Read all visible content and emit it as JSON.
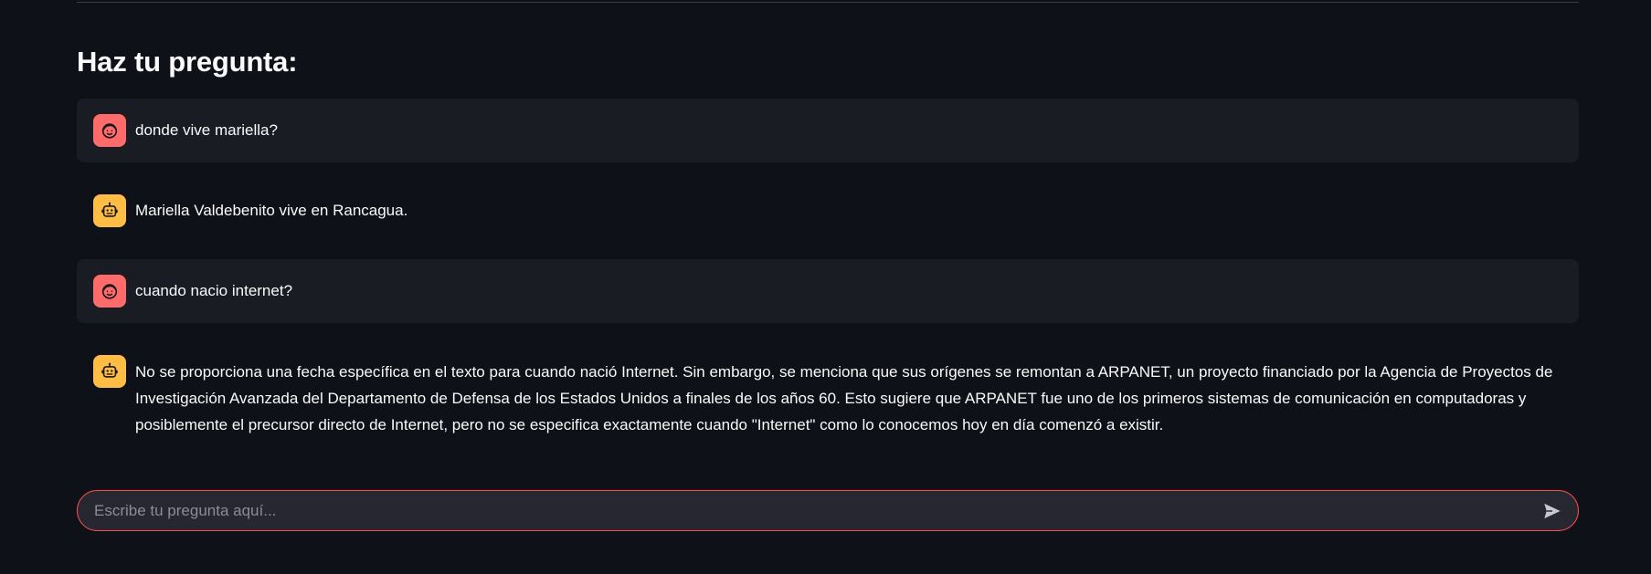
{
  "heading": "Haz tu pregunta:",
  "messages": [
    {
      "role": "user",
      "avatar_icon": "user-face-icon",
      "text": "donde vive mariella?"
    },
    {
      "role": "assistant",
      "avatar_icon": "robot-icon",
      "text": "Mariella Valdebenito vive en Rancagua."
    },
    {
      "role": "user",
      "avatar_icon": "user-face-icon",
      "text": "cuando nacio internet?"
    },
    {
      "role": "assistant",
      "avatar_icon": "robot-icon",
      "text": "No se proporciona una fecha específica en el texto para cuando nació Internet. Sin embargo, se menciona que sus orígenes se remontan a ARPANET, un proyecto financiado por la Agencia de Proyectos de Investigación Avanzada del Departamento de Defensa de los Estados Unidos a finales de los años 60. Esto sugiere que ARPANET fue uno de los primeros sistemas de comunicación en computadoras y posiblemente el precursor directo de Internet, pero no se especifica exactamente cuando \"Internet\" como lo conocemos hoy en día comenzó a existir."
    }
  ],
  "chat_input": {
    "placeholder": "Escribe tu pregunta aquí...",
    "value": "",
    "send_icon": "send-icon"
  },
  "colors": {
    "background": "#0e1117",
    "user_bubble": "#1a1c24",
    "user_avatar": "#ff6b6b",
    "assistant_avatar": "#ffbd45",
    "input_border": "#ff4b4b",
    "input_background": "#262730"
  }
}
